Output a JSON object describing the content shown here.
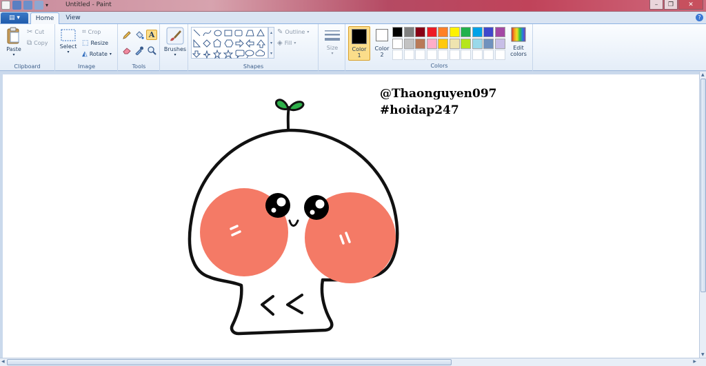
{
  "window": {
    "title": "Untitled - Paint",
    "controls": [
      "–",
      "❐",
      "✕"
    ]
  },
  "tabs": {
    "file_menu": "▤ ▾",
    "home": "Home",
    "view": "View",
    "help": "?"
  },
  "ribbon": {
    "clipboard": {
      "label": "Clipboard",
      "paste": "Paste",
      "cut": "Cut",
      "copy": "Copy"
    },
    "image": {
      "label": "Image",
      "select": "Select",
      "crop": "Crop",
      "resize": "Resize",
      "rotate": "Rotate"
    },
    "tools": {
      "label": "Tools",
      "items": [
        "pencil-icon",
        "fill-icon",
        "text-icon",
        "eraser-icon",
        "color-picker-icon",
        "magnifier-icon"
      ],
      "active": "text-icon"
    },
    "brushes": {
      "label": "Brushes"
    },
    "shapes": {
      "label": "Shapes",
      "outline": "Outline",
      "fill": "Fill"
    },
    "size": {
      "label": "Size"
    },
    "colors": {
      "label": "Colors",
      "color1_label": "Color\n1",
      "color1_line1": "Color",
      "color1_line2": "1",
      "color2_line1": "Color",
      "color2_line2": "2",
      "color1": "#000000",
      "color2": "#ffffff",
      "edit_colors_line1": "Edit",
      "edit_colors_line2": "colors",
      "palette_row1": [
        "#000000",
        "#7f7f7f",
        "#880015",
        "#ed1c24",
        "#ff7f27",
        "#fff200",
        "#22b14c",
        "#00a2e8",
        "#3f48cc",
        "#a349a4"
      ],
      "palette_row2": [
        "#ffffff",
        "#c3c3c3",
        "#b97a57",
        "#ffaec9",
        "#ffc90e",
        "#efe4b0",
        "#b5e61d",
        "#99d9ea",
        "#7092be",
        "#c8bfe7"
      ],
      "palette_row3": [
        "#ffffff",
        "#ffffff",
        "#ffffff",
        "#ffffff",
        "#ffffff",
        "#ffffff",
        "#ffffff",
        "#ffffff",
        "#ffffff",
        "#ffffff"
      ]
    }
  },
  "canvas": {
    "text_line1": "@Thaonguyen097",
    "text_line2": "#hoidap247",
    "drawing": "cute-mushroom-character-with-blush-cheeks",
    "blush_color": "#f47a66",
    "sprout_color": "#2eb04a"
  }
}
